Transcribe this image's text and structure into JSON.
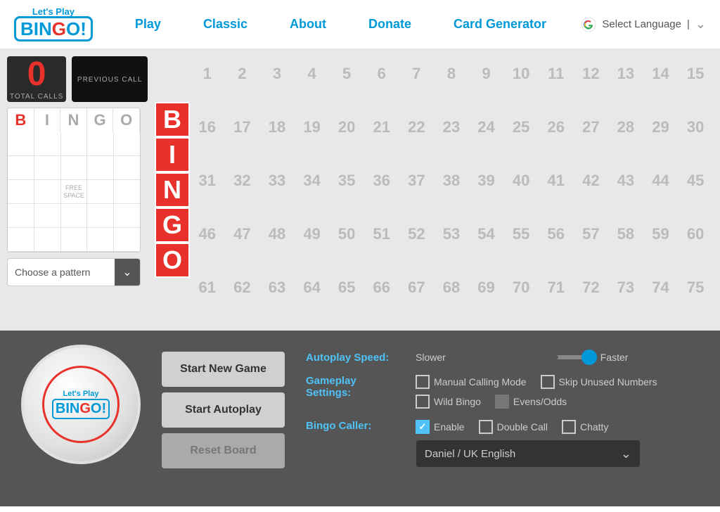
{
  "nav": {
    "logo_top": "Let's Play",
    "logo_bingo": "BINGO!",
    "links": [
      "Play",
      "Classic",
      "About",
      "Donate",
      "Card Generator"
    ],
    "lang_label": "Select Language",
    "lang_pipe": "|"
  },
  "board": {
    "total_calls": "0",
    "total_calls_label": "TOTAL CALLS",
    "previous_call_label": "PREVIOUS CALL",
    "bingo_letters": [
      "B",
      "I",
      "N",
      "G",
      "O"
    ],
    "card_headers": [
      "B",
      "I",
      "N",
      "G",
      "O"
    ],
    "free_space_text": "FREE\nSPACE",
    "pattern_placeholder": "Choose a pattern",
    "numbers": [
      [
        1,
        2,
        3,
        4,
        5,
        6,
        7,
        8,
        9,
        10,
        11,
        12,
        13,
        14,
        15
      ],
      [
        16,
        17,
        18,
        19,
        20,
        21,
        22,
        23,
        24,
        25,
        26,
        27,
        28,
        29,
        30
      ],
      [
        31,
        32,
        33,
        34,
        35,
        36,
        37,
        38,
        39,
        40,
        41,
        42,
        43,
        44,
        45
      ],
      [
        46,
        47,
        48,
        49,
        50,
        51,
        52,
        53,
        54,
        55,
        56,
        57,
        58,
        59,
        60
      ],
      [
        61,
        62,
        63,
        64,
        65,
        66,
        67,
        68,
        69,
        70,
        71,
        72,
        73,
        74,
        75
      ]
    ]
  },
  "bottom": {
    "ball_logo_top": "Let's Play",
    "ball_logo_bingo": "BINGO!",
    "buttons": {
      "start_new": "Start New Game",
      "start_auto": "Start Autoplay",
      "reset": "Reset Board"
    },
    "autoplay": {
      "label": "Autoplay Speed:",
      "slower": "Slower",
      "faster": "Faster"
    },
    "gameplay": {
      "label": "Gameplay Settings:",
      "manual_calling": "Manual Calling Mode",
      "skip_unused": "Skip Unused Numbers",
      "wild_bingo": "Wild Bingo",
      "evens_odds": "Evens/Odds"
    },
    "caller": {
      "label": "Bingo Caller:",
      "enable": "Enable",
      "double_call": "Double Call",
      "chatty": "Chatty",
      "selected": "Daniel / UK English"
    }
  }
}
